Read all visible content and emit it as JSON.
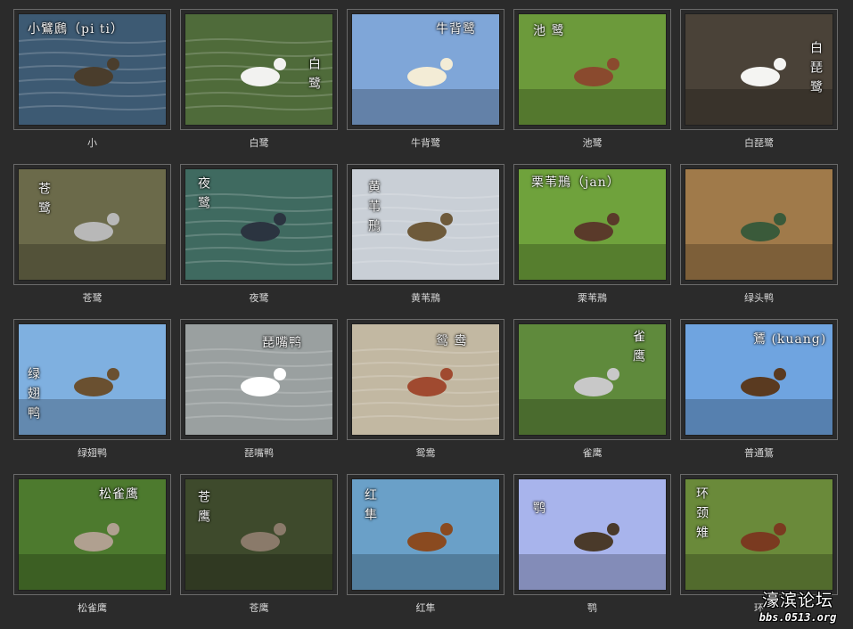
{
  "gallery": {
    "items": [
      {
        "caption": "小",
        "overlay": "小鷿鷉（pi ti）",
        "bg": "#3d5a73",
        "water": true,
        "bird": "#4a3d2c"
      },
      {
        "caption": "白鹭",
        "overlay": "白鹭",
        "bg": "#4f6b3a",
        "water": true,
        "bird": "#f2f2f0"
      },
      {
        "caption": "牛背鹭",
        "overlay": "牛背鹭",
        "bg": "#7fa6d8",
        "water": false,
        "bird": "#f3ecd6"
      },
      {
        "caption": "池鹭",
        "overlay": "池 鹭",
        "bg": "#6c9a3b",
        "water": false,
        "bird": "#8a4a2e"
      },
      {
        "caption": "白琵鹭",
        "overlay": "白琵鹭",
        "bg": "#4a4238",
        "water": false,
        "bird": "#f4f4f2"
      },
      {
        "caption": "苍鹭",
        "overlay": "苍鹭",
        "bg": "#6b6a4a",
        "water": false,
        "bird": "#b8b8b8"
      },
      {
        "caption": "夜鹭",
        "overlay": "夜鹭",
        "bg": "#3f6a60",
        "water": true,
        "bird": "#2b3440"
      },
      {
        "caption": "黄苇鳽",
        "overlay": "黄苇鳽",
        "bg": "#c9cfd6",
        "water": true,
        "bird": "#6e5a3a"
      },
      {
        "caption": "栗苇鳽",
        "overlay": "栗苇鳽（jan）",
        "bg": "#6fa23c",
        "water": false,
        "bird": "#5a3a2a"
      },
      {
        "caption": "绿头鸭",
        "overlay": "",
        "bg": "#a07a4a",
        "water": false,
        "bird": "#3a5a3a"
      },
      {
        "caption": "绿翅鸭",
        "overlay": "绿翅鸭",
        "bg": "#7fb0e0",
        "water": false,
        "bird": "#6a5030"
      },
      {
        "caption": "琵嘴鸭",
        "overlay": "琵嘴鸭",
        "bg": "#9aa0a0",
        "water": true,
        "bird": "#ffffff"
      },
      {
        "caption": "鸳鸯",
        "overlay": "鸳 鸯",
        "bg": "#c2b8a2",
        "water": true,
        "bird": "#a04a30"
      },
      {
        "caption": "雀鹰",
        "overlay": "雀鹰",
        "bg": "#5f8a3c",
        "water": false,
        "bird": "#c8c8c8"
      },
      {
        "caption": "普通鵟",
        "overlay": "鵟 (kuang)",
        "bg": "#6fa4e0",
        "water": false,
        "bird": "#5a3a20"
      },
      {
        "caption": "松雀鹰",
        "overlay": "松雀鹰",
        "bg": "#4d7a2e",
        "water": false,
        "bird": "#b0a090"
      },
      {
        "caption": "苍鹰",
        "overlay": "苍鹰",
        "bg": "#3e4a2c",
        "water": false,
        "bird": "#8a7a6a"
      },
      {
        "caption": "红隼",
        "overlay": "红隼",
        "bg": "#6aa0c8",
        "water": false,
        "bird": "#8a4a20"
      },
      {
        "caption": "鹗",
        "overlay": "鹗",
        "bg": "#a8b4ec",
        "water": false,
        "bird": "#4a3a2a"
      },
      {
        "caption": "环",
        "overlay": "环颈雉",
        "bg": "#6a8a3a",
        "water": false,
        "bird": "#7a3a20"
      }
    ]
  },
  "watermark": {
    "title": "濠滨论坛",
    "url": "bbs.0513.org"
  }
}
